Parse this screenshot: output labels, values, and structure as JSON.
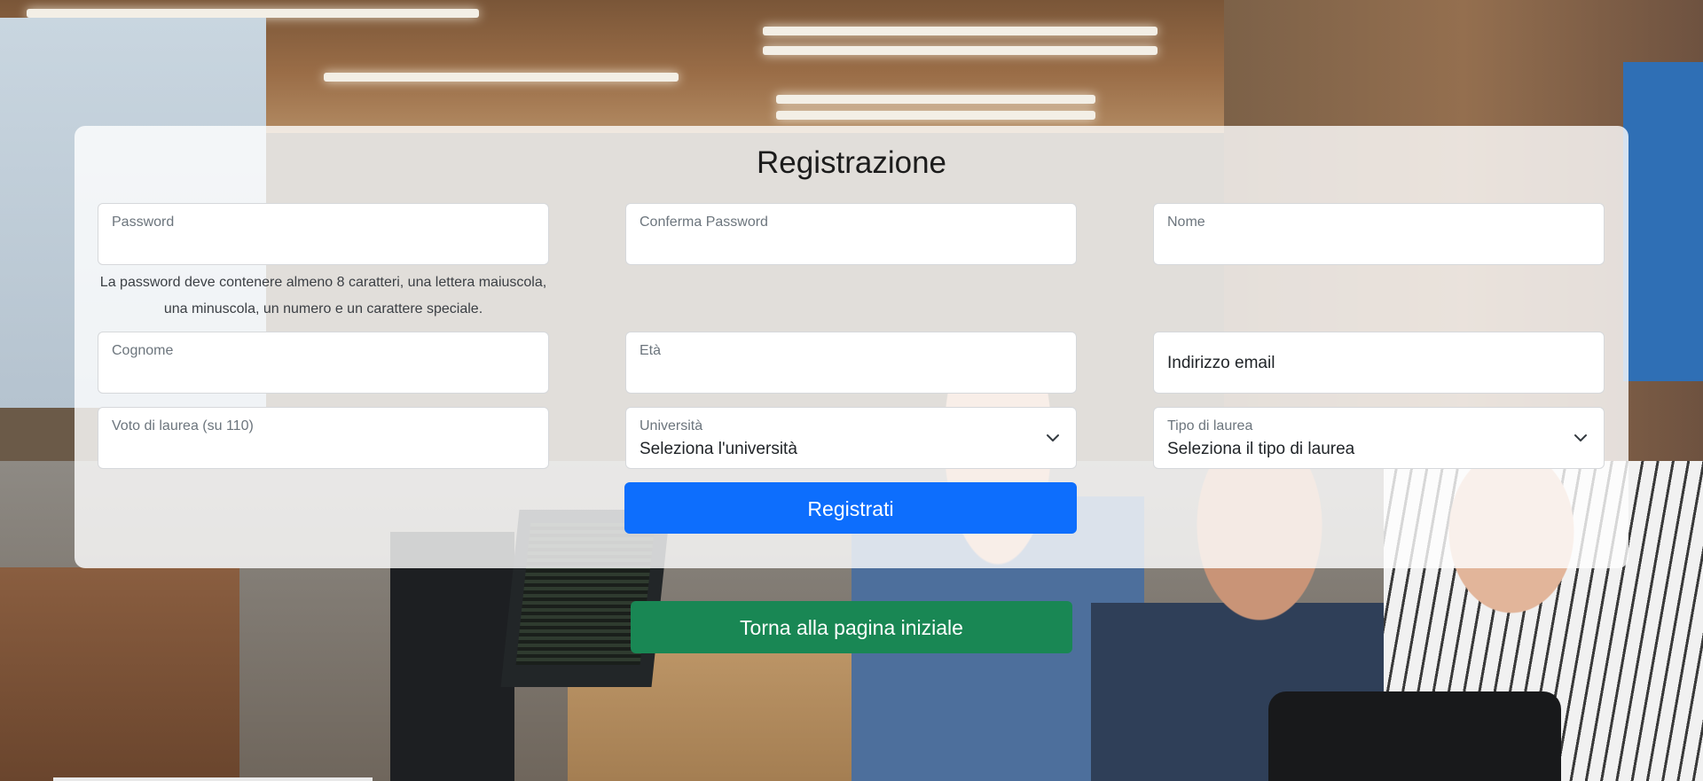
{
  "form": {
    "title": "Registrazione",
    "fields": {
      "password": {
        "label": "Password"
      },
      "confirm_password": {
        "label": "Conferma Password"
      },
      "first_name": {
        "label": "Nome"
      },
      "last_name": {
        "label": "Cognome"
      },
      "age": {
        "label": "Età"
      },
      "email": {
        "label": "Indirizzo email"
      },
      "grade": {
        "label": "Voto di laurea (su 110)"
      },
      "university": {
        "label": "Università",
        "selected": "Seleziona l'università"
      },
      "degree_type": {
        "label": "Tipo di laurea",
        "selected": "Seleziona il tipo di laurea"
      }
    },
    "password_hint": "La password deve contenere almeno 8 caratteri, una lettera maiuscola, una minuscola, un numero e un carattere speciale.",
    "submit_label": "Registrati"
  },
  "home_button_label": "Torna alla pagina iniziale",
  "colors": {
    "primary": "#0d6efd",
    "success": "#198754"
  },
  "icons": {
    "select_chevron": "chevron-down-icon"
  }
}
